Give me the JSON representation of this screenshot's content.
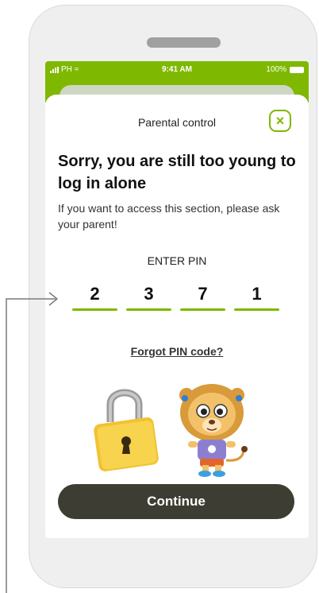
{
  "status_bar": {
    "carrier": "PH",
    "time": "9:41 AM",
    "battery": "100%"
  },
  "sheet": {
    "title": "Parental control",
    "close_icon": "close-icon",
    "heading": "Sorry, you are still too young to log in alone",
    "description": "If you want to access this section, please ask your parent!",
    "pin_label": "ENTER PIN",
    "pin_digits": [
      "2",
      "3",
      "7",
      "1"
    ],
    "forgot_label": "Forgot PIN code?",
    "continue_label": "Continue"
  },
  "illustrations": [
    "padlock-icon",
    "lion-mascot"
  ],
  "colors": {
    "accent": "#7fb800",
    "button": "#3e3d33",
    "background": "#efefef"
  }
}
